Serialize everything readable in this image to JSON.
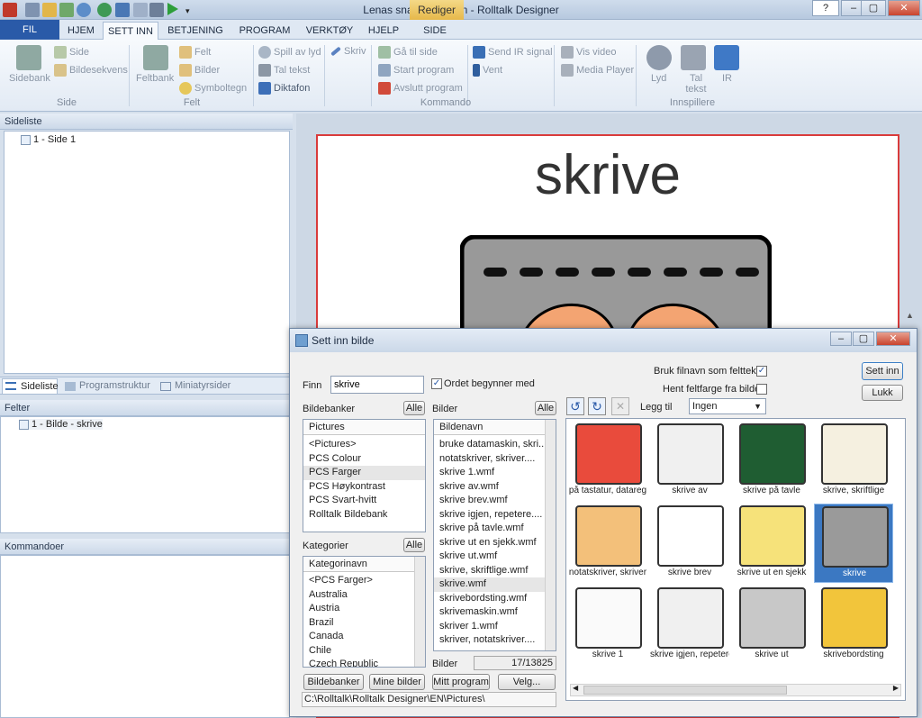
{
  "window": {
    "title": "Lenas snakkebok.psn - Rolltalk Designer",
    "context_tab": "Rediger",
    "minimize": "–",
    "maximize": "▢",
    "close": "✕",
    "help": "?"
  },
  "ribbon_tabs": [
    "FIL",
    "HJEM",
    "SETT INN",
    "BETJENING",
    "PROGRAM",
    "VERKTØY",
    "HJELP",
    "SIDE"
  ],
  "active_tab": "SETT INN",
  "ribbon": {
    "side_group": {
      "big": "Sidebank",
      "items": [
        "Side",
        "Bildesekvens"
      ],
      "label": "Side"
    },
    "felt_group": {
      "big": "Feltbank",
      "items": [
        "Felt",
        "Bilder",
        "Symboltegn"
      ],
      "label": "Felt"
    },
    "lyd_items": [
      "Spill av lyd",
      "Tal tekst",
      "Diktafon"
    ],
    "skriv": "Skriv",
    "kommando_items": [
      "Gå til side",
      "Start program",
      "Avslutt program"
    ],
    "ir_items": [
      "Send IR signal",
      "Vent"
    ],
    "video_items": [
      "Vis video",
      "Media Player"
    ],
    "kommando_label": "Kommando",
    "innspillere": {
      "items": [
        "Lyd",
        "Tal tekst",
        "IR"
      ],
      "label": "Innspillere"
    }
  },
  "sideliste": {
    "header": "Sideliste",
    "items": [
      "1 - Side 1"
    ],
    "tabs": [
      "Sideliste",
      "Programstruktur",
      "Miniatyrsider"
    ]
  },
  "felter": {
    "header": "Felter",
    "items": [
      "1 - Bilde - skrive"
    ]
  },
  "kommandoer": {
    "header": "Kommandoer"
  },
  "page_preview": {
    "word": "skrive"
  },
  "dialog": {
    "title": "Sett inn bilde",
    "finn_label": "Finn",
    "search_value": "skrive",
    "ordet_begynner": "Ordet begynner med",
    "bruk_filnavn": "Bruk filnavn som felttekst",
    "hent_feltfarge": "Hent feltfarge fra bilde",
    "sett_inn": "Sett inn",
    "lukk": "Lukk",
    "bildebanker_label": "Bildebanker",
    "alle": "Alle",
    "bildebanker_header": "Pictures",
    "bildebanker": [
      "<Pictures>",
      "PCS Colour",
      "PCS Farger",
      "PCS Høykontrast",
      "PCS Svart-hvitt",
      "Rolltalk Bildebank"
    ],
    "bildebanker_selected": 2,
    "kategorier_label": "Kategorier",
    "kategorier_header": "Kategorinavn",
    "kategorier": [
      "<PCS Farger>",
      "Australia",
      "Austria",
      "Brazil",
      "Canada",
      "Chile",
      "Czech Republic"
    ],
    "bilder_label": "Bilder",
    "bilder_header": "Bildenavn",
    "bilder": [
      "bruke datamaskin, skri...",
      "notatskriver, skriver....",
      "skrive 1.wmf",
      "skrive av.wmf",
      "skrive brev.wmf",
      "skrive igjen, repetere....",
      "skrive på tavle.wmf",
      "skrive ut en sjekk.wmf",
      "skrive ut.wmf",
      "skrive, skriftlige.wmf",
      "skrive.wmf",
      "skrivebordsting.wmf",
      "skrivemaskin.wmf",
      "skriver 1.wmf",
      "skriver, notatskriver...."
    ],
    "bilder_selected": 10,
    "bilder_count_label": "Bilder",
    "bilder_count": "17/13825",
    "legg_til_label": "Legg til",
    "legg_til_value": "Ingen",
    "bottom_buttons": [
      "Bildebanker",
      "Mine bilder",
      "Mitt program",
      "Velg..."
    ],
    "path": "C:\\Rolltalk\\Rolltalk Designer\\EN\\Pictures\\",
    "thumbnails": [
      "på tastatur, datareg",
      "skrive av",
      "skrive på tavle",
      "skrive, skriftlige",
      "notatskriver, skriver",
      "skrive brev",
      "skrive ut en sjekk",
      "skrive",
      "skrive 1",
      "skrive igjen, repetere",
      "skrive ut",
      "skrivebordsting"
    ],
    "thumb_selected": 7
  },
  "colors": {
    "accent": "#3b78c2",
    "file_tab": "#2a5aa8",
    "page_border": "#d93b3b"
  }
}
